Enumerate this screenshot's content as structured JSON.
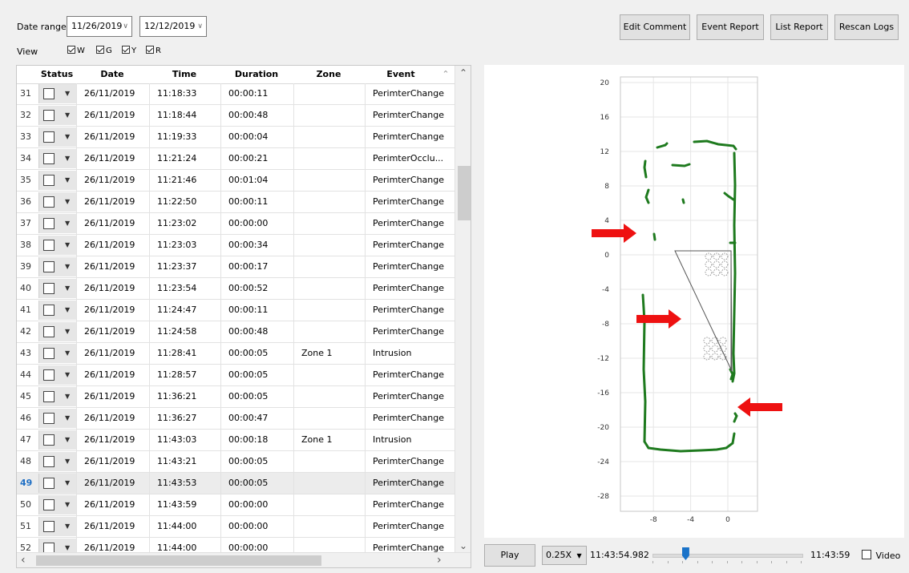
{
  "toolbar": {
    "date_range_label": "Date range",
    "date_from": "11/26/2019",
    "date_to": "12/12/2019",
    "view_label": "View",
    "view_checks": [
      {
        "label": "W",
        "checked": true
      },
      {
        "label": "G",
        "checked": true
      },
      {
        "label": "Y",
        "checked": true
      },
      {
        "label": "R",
        "checked": true
      }
    ],
    "buttons": {
      "edit_comment": "Edit Comment",
      "event_report": "Event Report",
      "list_report": "List Report",
      "rescan_logs": "Rescan Logs"
    }
  },
  "table": {
    "columns": [
      "Status",
      "Date",
      "Time",
      "Duration",
      "Zone",
      "Event"
    ],
    "selected_row": "49",
    "rows": [
      {
        "n": "31",
        "date": "26/11/2019",
        "time": "11:18:33",
        "duration": "00:00:11",
        "zone": "",
        "event": "PerimterChange"
      },
      {
        "n": "32",
        "date": "26/11/2019",
        "time": "11:18:44",
        "duration": "00:00:48",
        "zone": "",
        "event": "PerimterChange"
      },
      {
        "n": "33",
        "date": "26/11/2019",
        "time": "11:19:33",
        "duration": "00:00:04",
        "zone": "",
        "event": "PerimterChange"
      },
      {
        "n": "34",
        "date": "26/11/2019",
        "time": "11:21:24",
        "duration": "00:00:21",
        "zone": "",
        "event": "PerimterOcclu..."
      },
      {
        "n": "35",
        "date": "26/11/2019",
        "time": "11:21:46",
        "duration": "00:01:04",
        "zone": "",
        "event": "PerimterChange"
      },
      {
        "n": "36",
        "date": "26/11/2019",
        "time": "11:22:50",
        "duration": "00:00:11",
        "zone": "",
        "event": "PerimterChange"
      },
      {
        "n": "37",
        "date": "26/11/2019",
        "time": "11:23:02",
        "duration": "00:00:00",
        "zone": "",
        "event": "PerimterChange"
      },
      {
        "n": "38",
        "date": "26/11/2019",
        "time": "11:23:03",
        "duration": "00:00:34",
        "zone": "",
        "event": "PerimterChange"
      },
      {
        "n": "39",
        "date": "26/11/2019",
        "time": "11:23:37",
        "duration": "00:00:17",
        "zone": "",
        "event": "PerimterChange"
      },
      {
        "n": "40",
        "date": "26/11/2019",
        "time": "11:23:54",
        "duration": "00:00:52",
        "zone": "",
        "event": "PerimterChange"
      },
      {
        "n": "41",
        "date": "26/11/2019",
        "time": "11:24:47",
        "duration": "00:00:11",
        "zone": "",
        "event": "PerimterChange"
      },
      {
        "n": "42",
        "date": "26/11/2019",
        "time": "11:24:58",
        "duration": "00:00:48",
        "zone": "",
        "event": "PerimterChange"
      },
      {
        "n": "43",
        "date": "26/11/2019",
        "time": "11:28:41",
        "duration": "00:00:05",
        "zone": "Zone 1",
        "event": "Intrusion"
      },
      {
        "n": "44",
        "date": "26/11/2019",
        "time": "11:28:57",
        "duration": "00:00:05",
        "zone": "",
        "event": "PerimterChange"
      },
      {
        "n": "45",
        "date": "26/11/2019",
        "time": "11:36:21",
        "duration": "00:00:05",
        "zone": "",
        "event": "PerimterChange"
      },
      {
        "n": "46",
        "date": "26/11/2019",
        "time": "11:36:27",
        "duration": "00:00:47",
        "zone": "",
        "event": "PerimterChange"
      },
      {
        "n": "47",
        "date": "26/11/2019",
        "time": "11:43:03",
        "duration": "00:00:18",
        "zone": "Zone 1",
        "event": "Intrusion"
      },
      {
        "n": "48",
        "date": "26/11/2019",
        "time": "11:43:21",
        "duration": "00:00:05",
        "zone": "",
        "event": "PerimterChange"
      },
      {
        "n": "49",
        "date": "26/11/2019",
        "time": "11:43:53",
        "duration": "00:00:05",
        "zone": "",
        "event": "PerimterChange"
      },
      {
        "n": "50",
        "date": "26/11/2019",
        "time": "11:43:59",
        "duration": "00:00:00",
        "zone": "",
        "event": "PerimterChange"
      },
      {
        "n": "51",
        "date": "26/11/2019",
        "time": "11:44:00",
        "duration": "00:00:00",
        "zone": "",
        "event": "PerimterChange"
      },
      {
        "n": "52",
        "date": "26/11/2019",
        "time": "11:44:00",
        "duration": "00:00:00",
        "zone": "",
        "event": "PerimterChange"
      }
    ]
  },
  "plot": {
    "y_ticks": [
      "20",
      "16",
      "12",
      "8",
      "4",
      "0",
      "-4",
      "-8",
      "-12",
      "-16",
      "-20",
      "-24",
      "-28"
    ],
    "x_ticks": [
      "-8",
      "-4",
      "0"
    ],
    "perimeter_color": "#1e7a1e",
    "arrow_color": "#ee1111"
  },
  "player": {
    "play_label": "Play",
    "speed": "0.25X",
    "current_time": "11:43:54.982",
    "end_time": "11:43:59",
    "video_label": "Video",
    "video_checked": false,
    "slider_position": 0.22
  }
}
